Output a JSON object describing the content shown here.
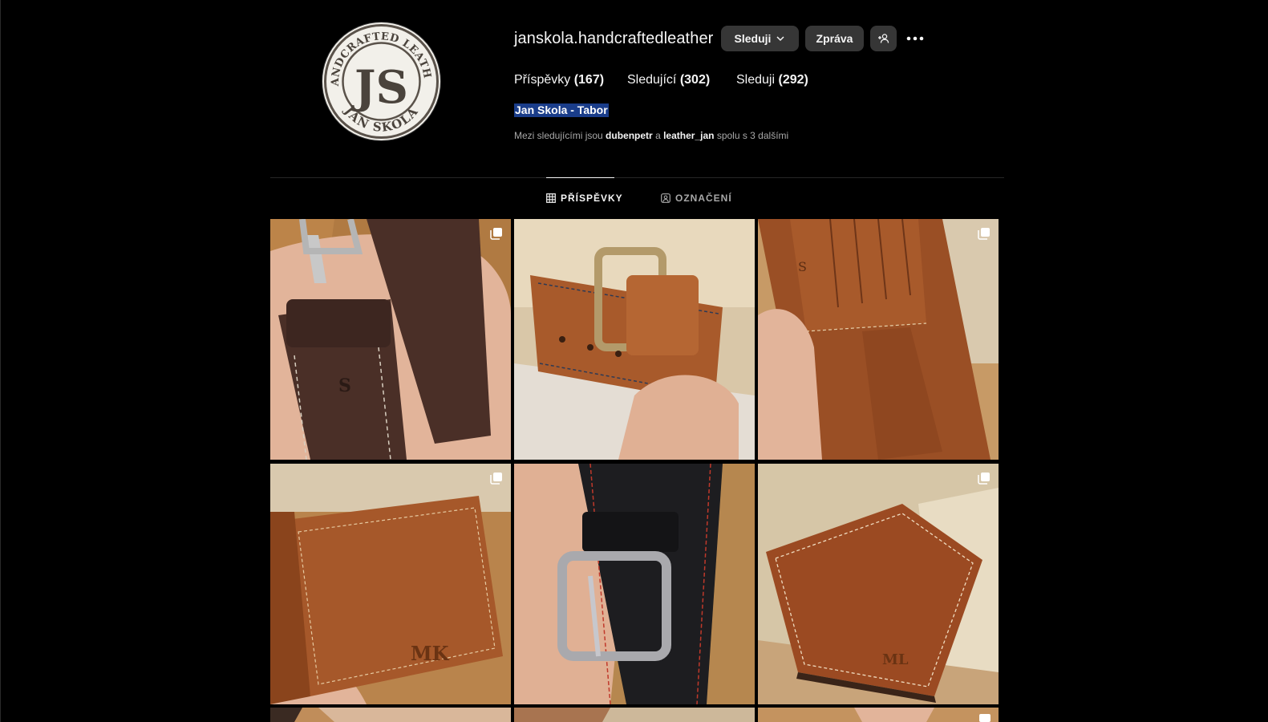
{
  "profile": {
    "username": "janskola.handcraftedleather",
    "full_name": "Jan Skola - Tabor",
    "avatar_logo": {
      "top_text": "HANDCRAFTED LEATHER",
      "bottom_text": "JAN SKOLA",
      "monogram": "JS"
    }
  },
  "actions": {
    "follow_label": "Sleduji",
    "message_label": "Zpráva"
  },
  "stats": {
    "posts_label": "Příspěvky",
    "posts_count": "(167)",
    "followers_label": "Sledující",
    "followers_count": "(302)",
    "following_label": "Sleduji",
    "following_count": "(292)"
  },
  "mutuals": {
    "prefix": "Mezi sledujícími jsou",
    "user1": "dubenpetr",
    "joiner": "a",
    "user2": "leather_jan",
    "suffix": "spolu s 3 dalšími"
  },
  "tabs": [
    {
      "label": "PŘÍSPĚVKY",
      "icon": "grid-icon",
      "active": true
    },
    {
      "label": "OZNAČENÍ",
      "icon": "tagged-icon",
      "active": false
    }
  ],
  "posts": [
    {
      "subject": "dark brown belt with JS stamp",
      "multi": true
    },
    {
      "subject": "tan belt with brass buckle",
      "multi": false
    },
    {
      "subject": "open tan bifold wallet",
      "multi": true
    },
    {
      "subject": "tan money clip wallet MK",
      "multi": true
    },
    {
      "subject": "black belt with red stitching",
      "multi": false
    },
    {
      "subject": "tan bifold wallet ML",
      "multi": true
    }
  ],
  "colors": {
    "background": "#000000",
    "button": "#363636",
    "selection": "#1a3d8a",
    "secondary_text": "#a8a8a8"
  }
}
